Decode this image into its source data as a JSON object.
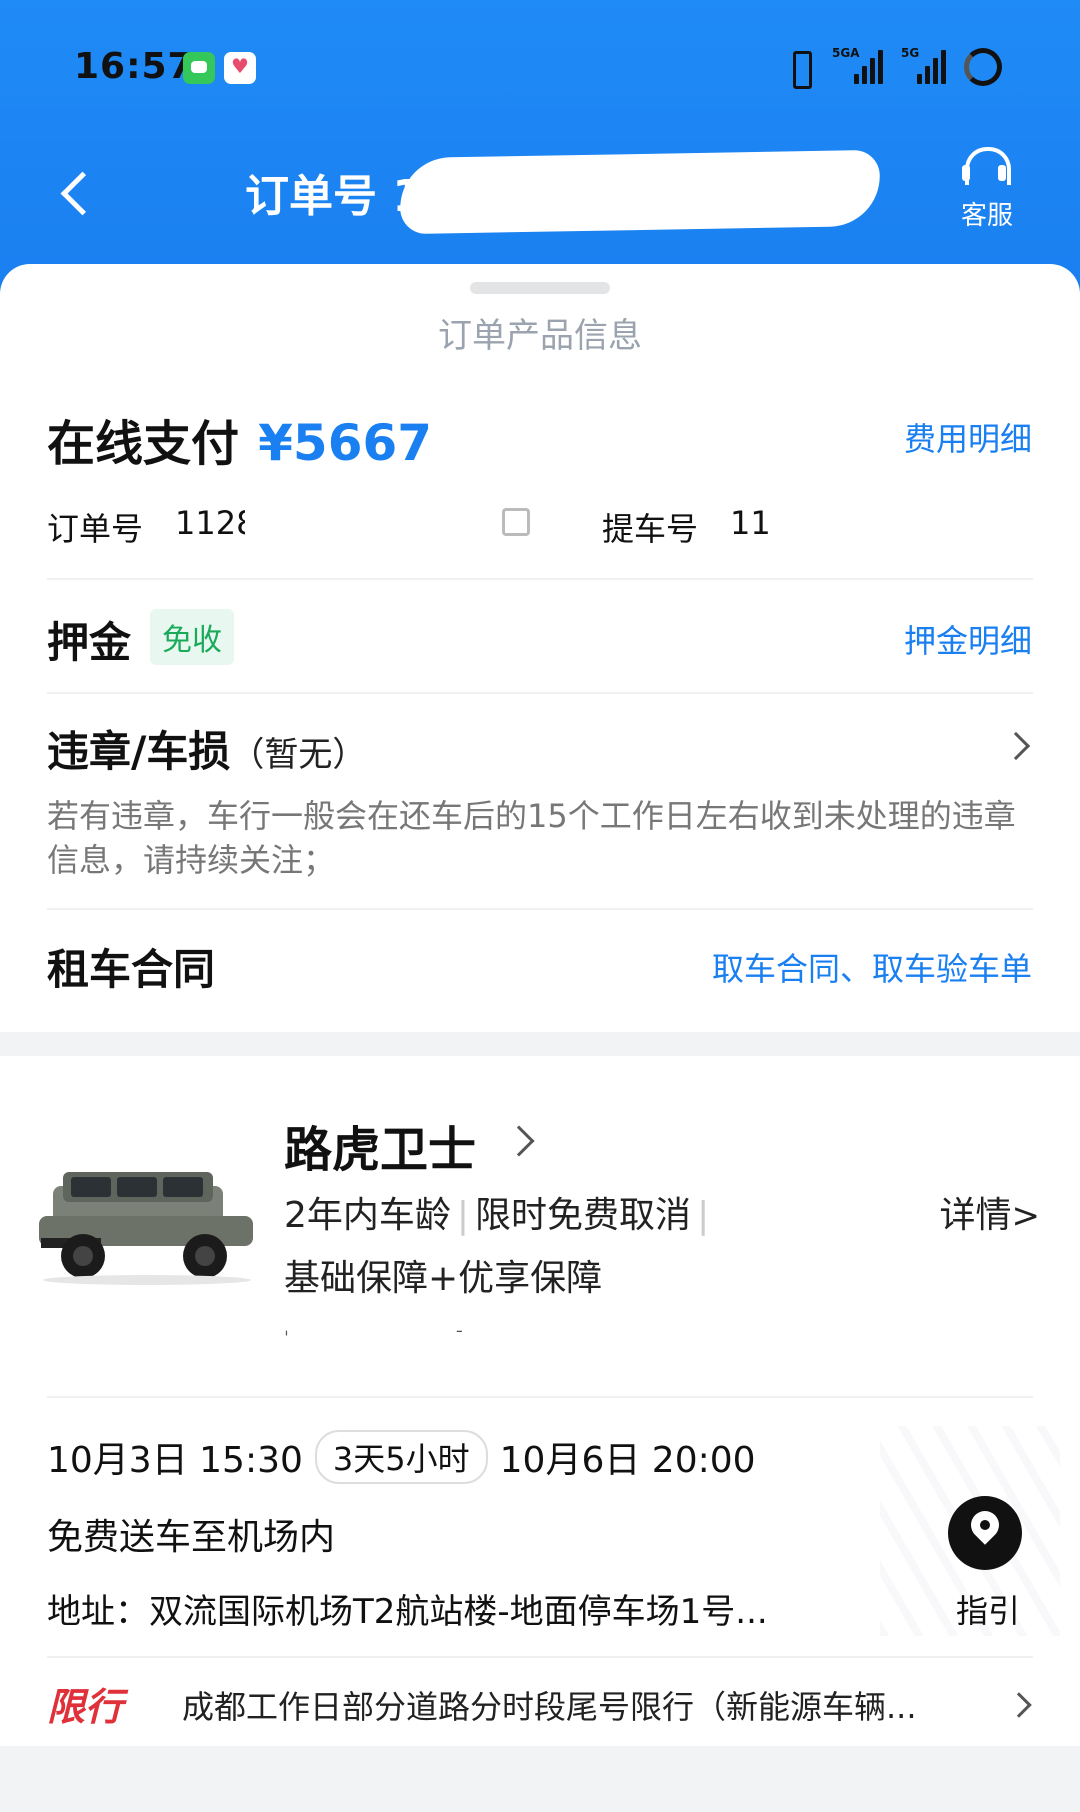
{
  "status_bar": {
    "time": "16:57",
    "signal1": "5GA",
    "signal2": "5G"
  },
  "nav": {
    "title": "订单号 112",
    "service_label": "客服"
  },
  "order_info": {
    "caption": "订单产品信息",
    "pay_label": "在线支付",
    "pay_amount": "¥5667",
    "fee_detail_link": "费用明细",
    "order_no_label": "订单号",
    "order_no": "1128",
    "pickup_no_label": "提车号",
    "pickup_no": "11"
  },
  "deposit": {
    "title": "押金",
    "badge": "免收",
    "link": "押金明细"
  },
  "violation": {
    "title": "违章/车损",
    "status": "（暂无）",
    "note": "若有违章，车行一般会在还车后的15个工作日左右收到未处理的违章信息，请持续关注；"
  },
  "contract": {
    "title": "租车合同",
    "link": "取车合同、取车验车单"
  },
  "car": {
    "name": "路虎卫士",
    "tag1": "2年内车龄",
    "tag2": "限时免费取消",
    "detail": "详情",
    "protection": "基础保障+优享保障",
    "pickup_time": "10月3日 15:30",
    "duration": "3天5小时",
    "return_time": "10月6日 20:00",
    "delivery": "免费送车至机场内",
    "address": "地址：双流国际机场T2航站楼-地面停车场1号...",
    "guide_label": "指引",
    "restrict_tag": "限行",
    "restrict_text": "成都工作日部分道路分时段尾号限行（新能源车辆..."
  },
  "colors": {
    "brand_blue": "#1a7ff0",
    "badge_green": "#1aab5a",
    "restrict_red": "#e0303a"
  }
}
